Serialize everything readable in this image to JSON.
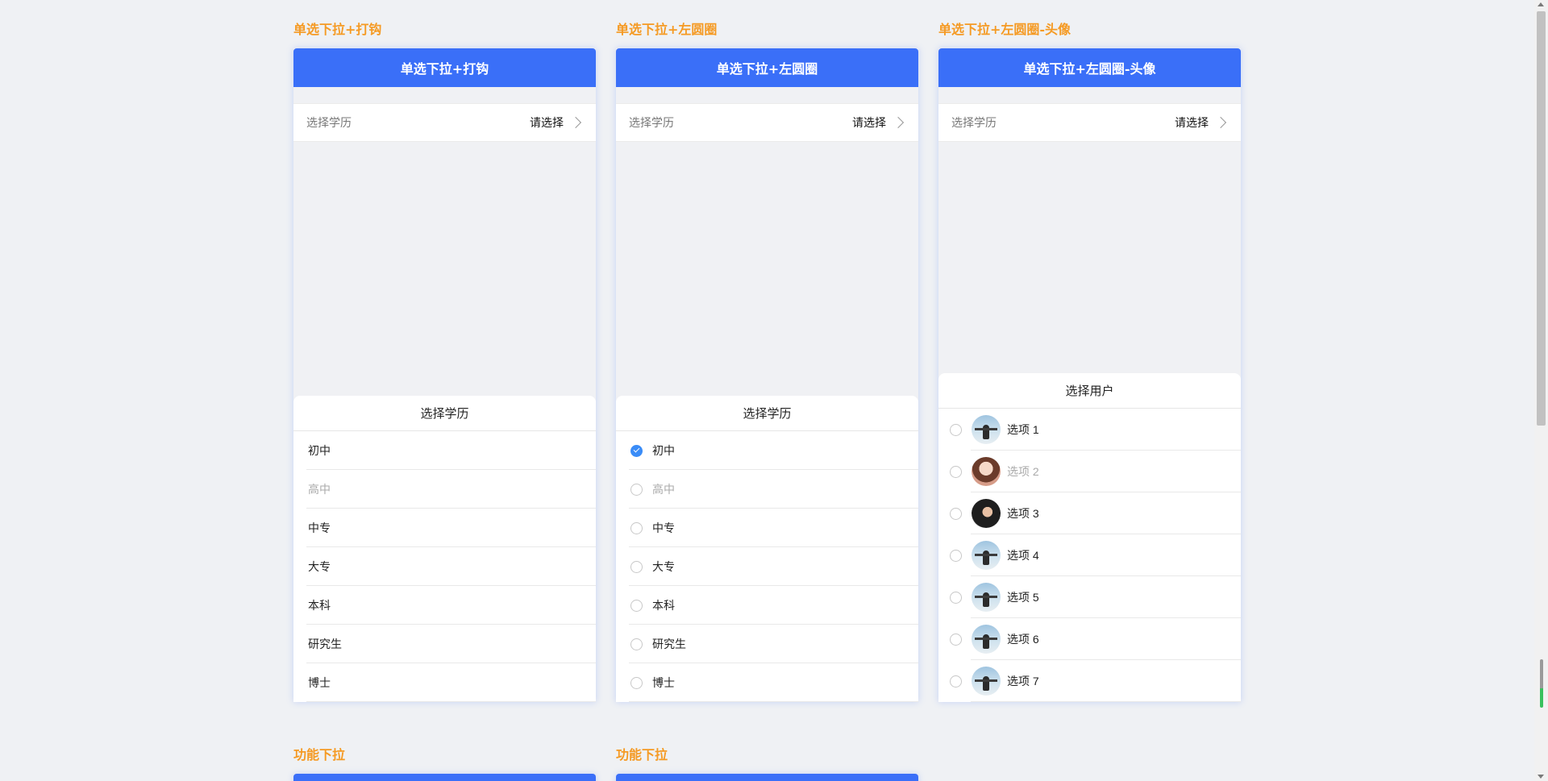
{
  "sections": [
    {
      "title": "单选下拉+打钩",
      "header": "单选下拉+打钩",
      "field_label": "选择学历",
      "field_value": "请选择",
      "sheet_title": "选择学历",
      "options": [
        "初中",
        "高中",
        "中专",
        "大专",
        "本科",
        "研究生",
        "博士"
      ],
      "disabled_index": 1
    },
    {
      "title": "单选下拉+左圆圈",
      "header": "单选下拉+左圆圈",
      "field_label": "选择学历",
      "field_value": "请选择",
      "sheet_title": "选择学历",
      "options": [
        "初中",
        "高中",
        "中专",
        "大专",
        "本科",
        "研究生",
        "博士"
      ],
      "selected_index": 0,
      "disabled_index": 1
    },
    {
      "title": "单选下拉+左圆圈-头像",
      "header": "单选下拉+左圆圈-头像",
      "field_label": "选择学历",
      "field_value": "请选择",
      "sheet_title": "选择用户",
      "options": [
        "选项 1",
        "选项 2",
        "选项 3",
        "选项 4",
        "选项 5",
        "选项 6",
        "选项 7"
      ],
      "avatars": [
        "sky-avatar",
        "girl-avatar",
        "dark-avatar",
        "sky-avatar",
        "sky-avatar",
        "sky-avatar",
        "sky-avatar"
      ],
      "disabled_index": 1
    }
  ],
  "bottom_sections": [
    "功能下拉",
    "功能下拉"
  ],
  "colors": {
    "accent": "#3a6ff8",
    "section_title": "#f59a23",
    "check": "#3a8cf7"
  }
}
